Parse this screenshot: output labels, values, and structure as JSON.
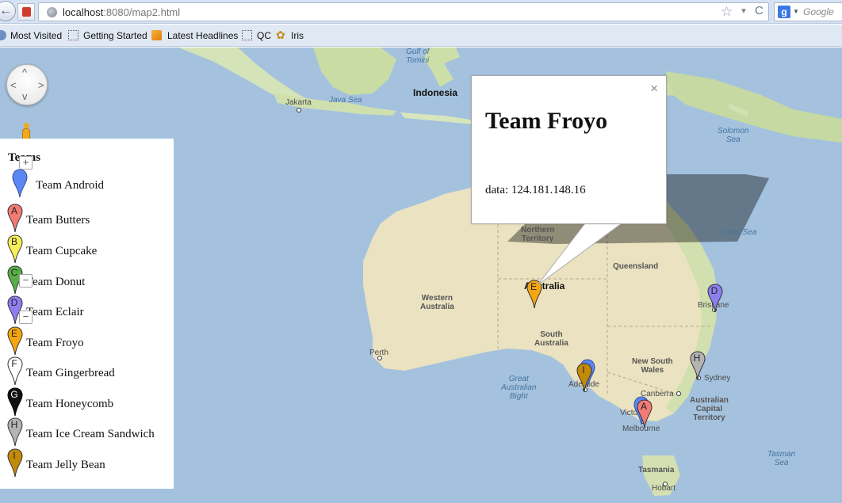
{
  "browser": {
    "url_host": "localhost",
    "url_rest": ":8080/map2.html",
    "search_placeholder": "Google",
    "bookmarks": [
      {
        "label": "Most Visited"
      },
      {
        "label": "Getting Started"
      },
      {
        "label": "Latest Headlines"
      },
      {
        "label": "QC"
      },
      {
        "label": "Iris"
      }
    ]
  },
  "legend": {
    "title": "Teams",
    "items": [
      {
        "letter": "",
        "label": "Team Android",
        "color": "#5c87f2"
      },
      {
        "letter": "A",
        "label": "Team Butters",
        "color": "#f27b75"
      },
      {
        "letter": "B",
        "label": "Team Cupcake",
        "color": "#f7ef5a"
      },
      {
        "letter": "C",
        "label": "Team Donut",
        "color": "#5aae4a"
      },
      {
        "letter": "D",
        "label": "Team Eclair",
        "color": "#8d7ff0"
      },
      {
        "letter": "E",
        "label": "Team Froyo",
        "color": "#f5a50f"
      },
      {
        "letter": "F",
        "label": "Team Gingerbread",
        "color": "#ffffff"
      },
      {
        "letter": "G",
        "label": "Team Honeycomb",
        "color": "#111111"
      },
      {
        "letter": "H",
        "label": "Team Ice Cream Sandwich",
        "color": "#b4b4b4"
      },
      {
        "letter": "I",
        "label": "Team Jelly Bean",
        "color": "#c28a08"
      }
    ]
  },
  "info_window": {
    "title": "Team Froyo",
    "data": "data: 124.181.148.16",
    "close": "×"
  },
  "map_labels": {
    "gulf_of_tomini": "Gulf of\nTomini",
    "indonesia": "Indonesia",
    "jakarta": "Jakarta",
    "java_sea": "Java Sea",
    "solomon_sea": "Solomon\nSea",
    "coral_sea": "Coral Sea",
    "northern_territory": "Northern\nTerritory",
    "queensland": "Queensland",
    "western_australia": "Western\nAustralia",
    "australia": "Australia",
    "south_australia": "South\nAustralia",
    "brisbane": "Brisbane",
    "perth": "Perth",
    "great_australian_bight": "Great\nAustralian\nBight",
    "adelaide": "Adelaide",
    "new_south_wales": "New South\nWales",
    "sydney": "Sydney",
    "canberra": "Canberra",
    "act": "Australian\nCapital\nTerritory",
    "victoria": "Victoria",
    "melbourne": "Melbourne",
    "tasmania": "Tasmania",
    "hobart": "Hobart",
    "tasman_sea": "Tasman\nSea"
  },
  "map_markers": [
    {
      "letter": "E",
      "team": "Team Froyo",
      "color": "#f5a50f"
    },
    {
      "letter": "D",
      "team": "Team Eclair",
      "color": "#8d7ff0"
    },
    {
      "letter": "H",
      "team": "Team Ice Cream Sandwich",
      "color": "#b4b4b4"
    },
    {
      "letter": "",
      "team": "Team Android",
      "color": "#5c87f2"
    },
    {
      "letter": "I",
      "team": "Team Jelly Bean",
      "color": "#c28a08"
    },
    {
      "letter": "",
      "team": "Team Android",
      "color": "#5c87f2"
    },
    {
      "letter": "A",
      "team": "Team Butters",
      "color": "#f27b75"
    }
  ],
  "colors": {
    "ocean": "#a4c2de",
    "land": "#eae2c0",
    "land_green": "#c7d9a6"
  }
}
